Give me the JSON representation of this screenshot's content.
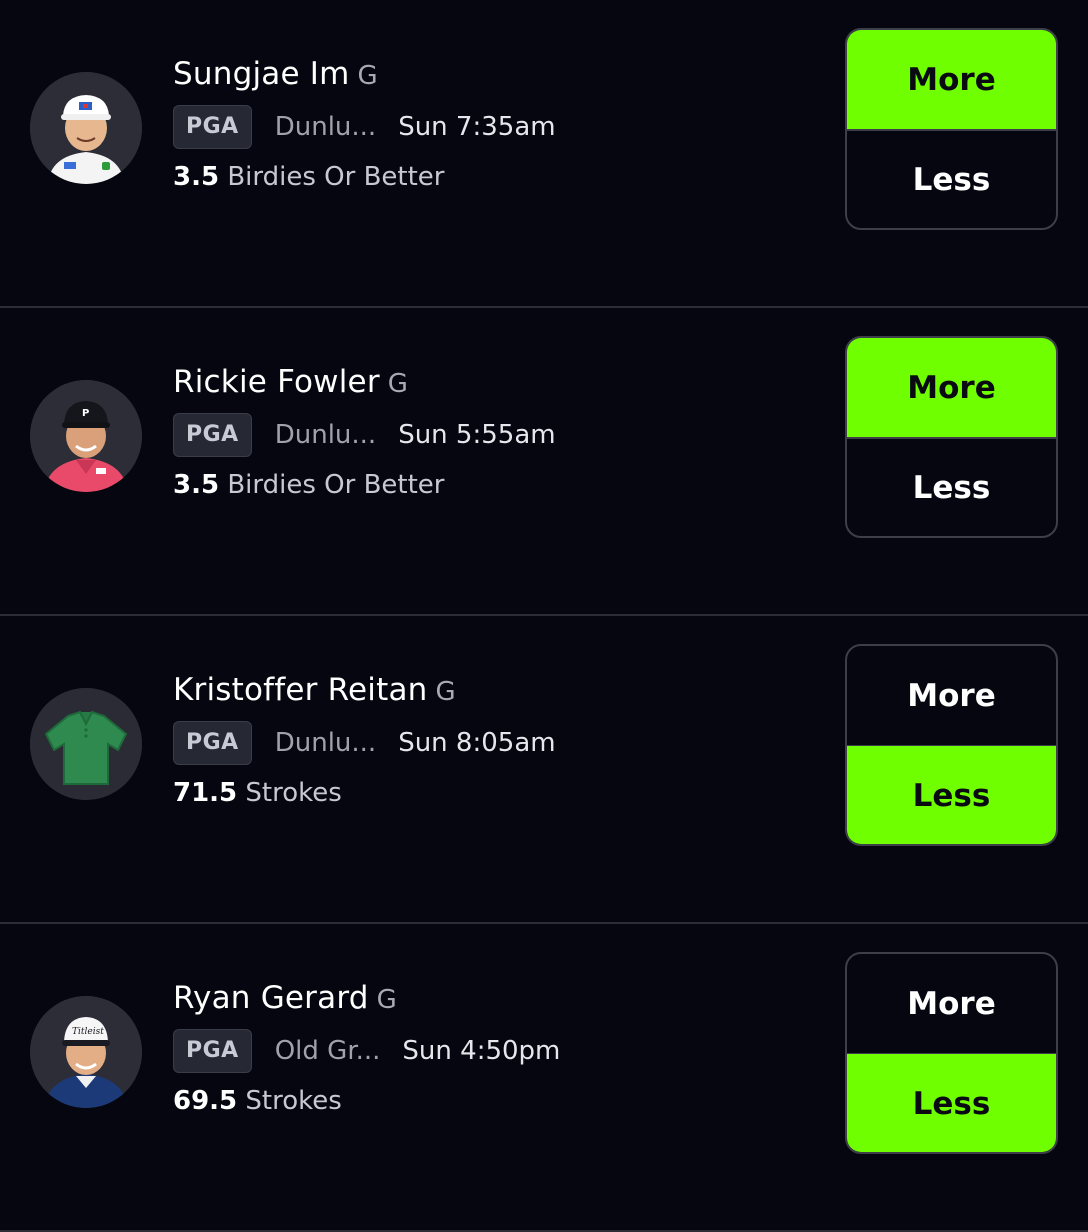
{
  "colors": {
    "background": "#05060f",
    "accent": "#6fff00",
    "divider": "#2a2c36"
  },
  "picks": [
    {
      "name": "Sungjae Im",
      "position": "G",
      "league": "PGA",
      "course": "Dunlu...",
      "time": "Sun 7:35am",
      "stat_value": "3.5",
      "stat_label": "Birdies Or Better",
      "more_label": "More",
      "less_label": "Less",
      "selected": "More",
      "avatar_icon": "player-photo-white-cap"
    },
    {
      "name": "Rickie Fowler",
      "position": "G",
      "league": "PGA",
      "course": "Dunlu...",
      "time": "Sun 5:55am",
      "stat_value": "3.5",
      "stat_label": "Birdies Or Better",
      "more_label": "More",
      "less_label": "Less",
      "selected": "More",
      "avatar_icon": "player-photo-black-cap-pink-shirt"
    },
    {
      "name": "Kristoffer Reitan",
      "position": "G",
      "league": "PGA",
      "course": "Dunlu...",
      "time": "Sun 8:05am",
      "stat_value": "71.5",
      "stat_label": "Strokes",
      "more_label": "More",
      "less_label": "Less",
      "selected": "Less",
      "avatar_icon": "green-shirt-placeholder"
    },
    {
      "name": "Ryan Gerard",
      "position": "G",
      "league": "PGA",
      "course": "Old Gr...",
      "time": "Sun 4:50pm",
      "stat_value": "69.5",
      "stat_label": "Strokes",
      "more_label": "More",
      "less_label": "Less",
      "selected": "Less",
      "avatar_icon": "player-photo-white-cap-navy-shirt"
    }
  ]
}
